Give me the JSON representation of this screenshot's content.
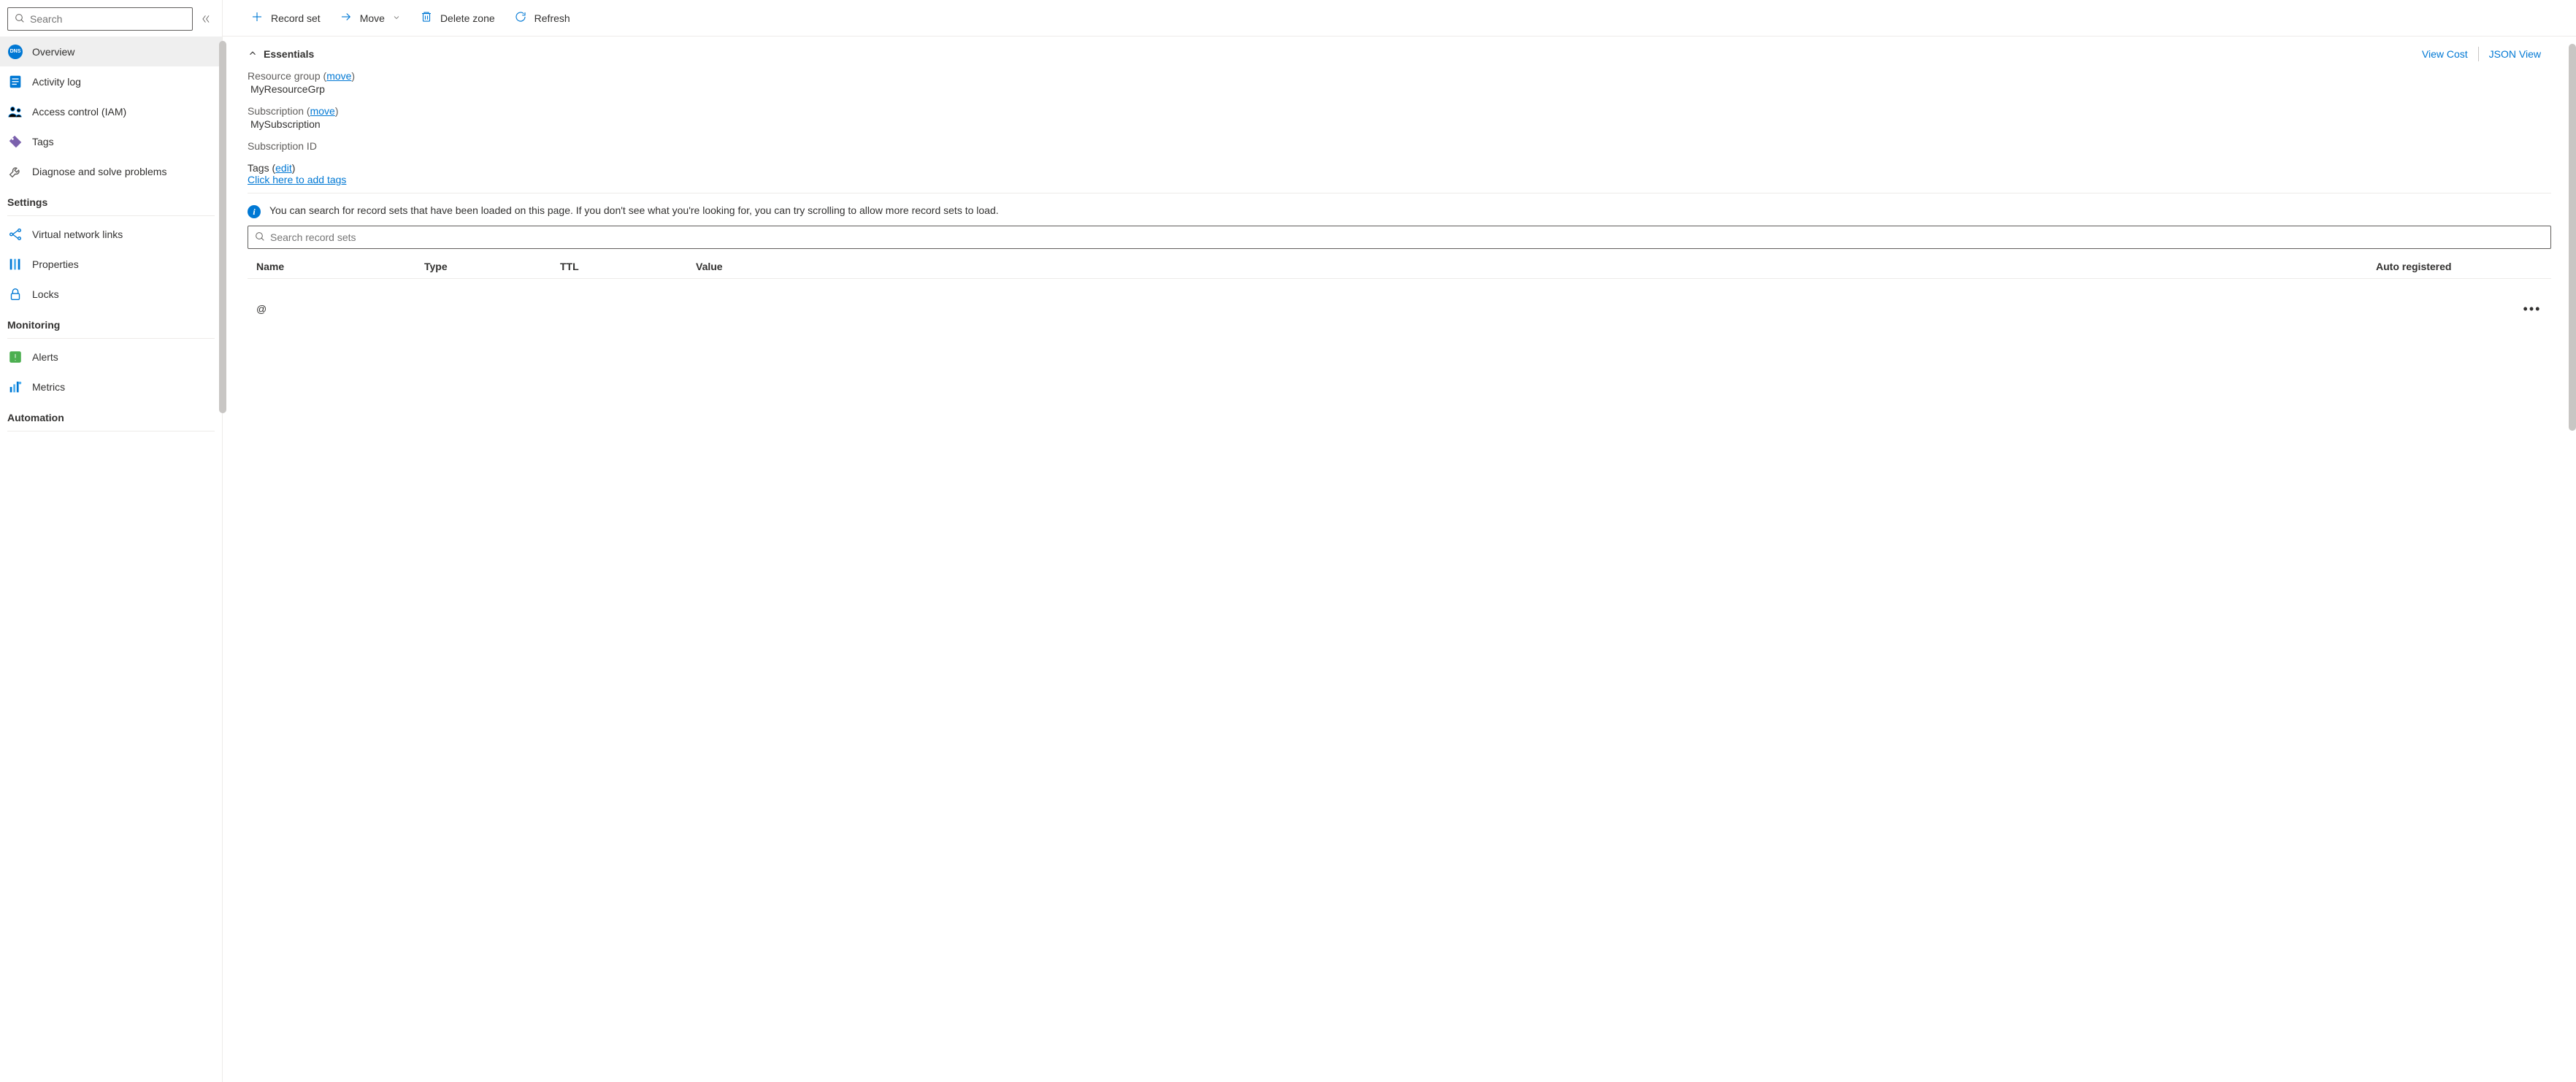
{
  "sidebar": {
    "search_placeholder": "Search",
    "items": [
      {
        "label": "Overview"
      },
      {
        "label": "Activity log"
      },
      {
        "label": "Access control (IAM)"
      },
      {
        "label": "Tags"
      },
      {
        "label": "Diagnose and solve problems"
      }
    ],
    "sections": {
      "settings": {
        "title": "Settings",
        "items": [
          {
            "label": "Virtual network links"
          },
          {
            "label": "Properties"
          },
          {
            "label": "Locks"
          }
        ]
      },
      "monitoring": {
        "title": "Monitoring",
        "items": [
          {
            "label": "Alerts"
          },
          {
            "label": "Metrics"
          }
        ]
      },
      "automation": {
        "title": "Automation"
      }
    }
  },
  "toolbar": {
    "record_set_label": "Record set",
    "move_label": "Move",
    "delete_zone_label": "Delete zone",
    "refresh_label": "Refresh"
  },
  "essentials": {
    "title": "Essentials",
    "view_cost_label": "View Cost",
    "json_view_label": "JSON View",
    "resource_group_label": "Resource group",
    "resource_group_move": "move",
    "resource_group_value": "MyResourceGrp",
    "subscription_label": "Subscription",
    "subscription_move": "move",
    "subscription_value": "MySubscription",
    "subscription_id_label": "Subscription ID",
    "tags_label": "Tags",
    "tags_edit": "edit",
    "tags_add": "Click here to add tags"
  },
  "records": {
    "info_text": "You can search for record sets that have been loaded on this page. If you don't see what you're looking for, you can try scrolling to allow more record sets to load.",
    "search_placeholder": "Search record sets",
    "columns": {
      "name": "Name",
      "type": "Type",
      "ttl": "TTL",
      "value": "Value",
      "auto": "Auto registered"
    },
    "rows": [
      {
        "name": "@"
      }
    ]
  }
}
